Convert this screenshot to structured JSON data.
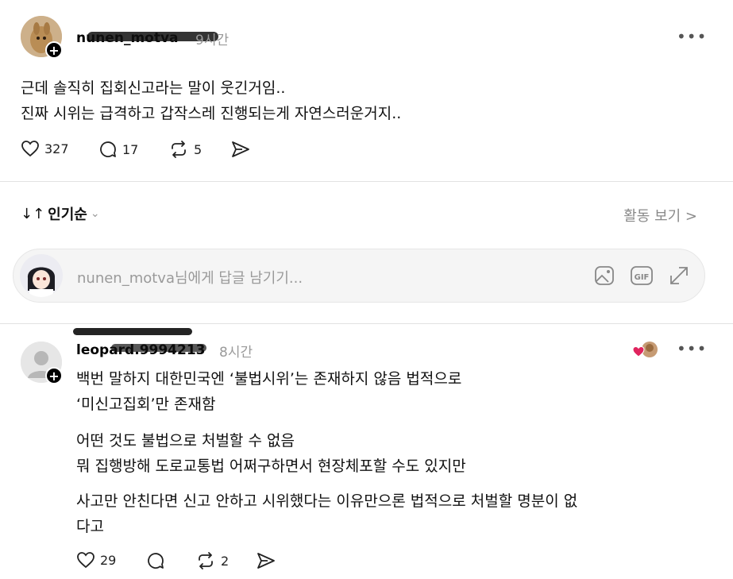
{
  "post": {
    "username": "nunen_motva",
    "time": "9시간",
    "lines": [
      "근데 솔직히 집회신고라는 말이 웃긴거임..",
      "진짜 시위는 급격하고 갑작스레 진행되는게 자연스러운거지.."
    ],
    "likes": "327",
    "comments": "17",
    "reposts": "5"
  },
  "sort": {
    "label": "인기순"
  },
  "activity": {
    "label": "활동 보기 >"
  },
  "reply": {
    "placeholder": "nunen_motva님에게 답글 남기기..."
  },
  "comment": {
    "username": "leopard.9994213",
    "time": "8시간",
    "lines": [
      "백번 말하지 대한민국엔 ‘불법시위’는 존재하지 않음 법적으로",
      "‘미신고집회’만 존재함",
      "어떤 것도 불법으로 처벌할 수 없음",
      "뭐 집행방해 도로교통법 어쩌구하면서 현장체포할 수도 있지만",
      "사고만 안친다면 신고 안하고 시위했다는 이유만으론 법적으로 처벌할 명분이 없",
      "다고"
    ],
    "likes": "29",
    "reposts": "2"
  },
  "icons": {
    "more": "more-icon",
    "heart": "heart-icon",
    "comment": "comment-icon",
    "repost": "repost-icon",
    "share": "share-icon",
    "image": "image-icon",
    "gif": "gif-icon",
    "expand": "expand-icon"
  },
  "colors": {
    "liked_heart": "#e0245e"
  }
}
